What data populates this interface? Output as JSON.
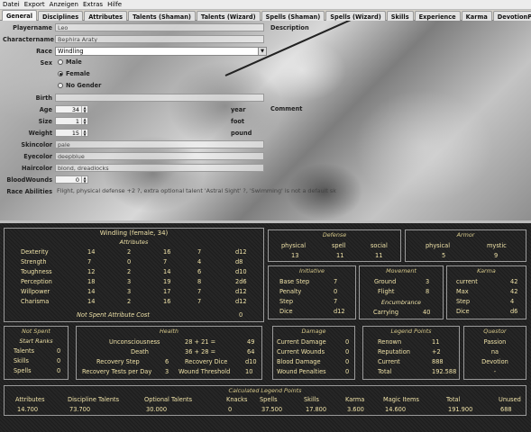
{
  "menu": [
    "Datei",
    "Export",
    "Anzeigen",
    "Extras",
    "Hilfe"
  ],
  "tabs": [
    "General",
    "Disciplines",
    "Attributes",
    "Talents (Shaman)",
    "Talents (Wizard)",
    "Spells (Shaman)",
    "Spells (Wizard)",
    "Skills",
    "Experience",
    "Karma",
    "DevotionPoints"
  ],
  "general": {
    "playername_label": "Playername",
    "playername": "Leo",
    "charactername_label": "Charactername",
    "charactername": "Bephira Araty",
    "race_label": "Race",
    "race": "Windling",
    "sex_label": "Sex",
    "sex_options": [
      "Male",
      "Female",
      "No Gender"
    ],
    "birth_label": "Birth",
    "birth": "",
    "age_label": "Age",
    "age": "34",
    "age_unit": "year",
    "size_label": "Size",
    "size": "1",
    "size_unit": "foot",
    "weight_label": "Weight",
    "weight": "15",
    "weight_unit": "pound",
    "skincolor_label": "Skincolor",
    "skincolor": "pale",
    "eyecolor_label": "Eyecolor",
    "eyecolor": "deepblue",
    "haircolor_label": "Haircolor",
    "haircolor": "blond, dreadlocks",
    "bloodwounds_label": "BloodWounds",
    "bloodwounds": "0",
    "raceabilities_label": "Race Abilities",
    "raceabilities": "Flight, physical defense +2 ?, extra optional talent 'Astral Sight' ?, 'Swimming' is not a default skill",
    "description_label": "Description",
    "comment_label": "Comment"
  },
  "sheet": {
    "title": "Windling (female, 34)",
    "attributes": {
      "header": "Attributes",
      "rows": [
        [
          "Dexterity",
          "14",
          "2",
          "16",
          "7",
          "d12"
        ],
        [
          "Strength",
          "7",
          "0",
          "7",
          "4",
          "d8"
        ],
        [
          "Toughness",
          "12",
          "2",
          "14",
          "6",
          "d10"
        ],
        [
          "Perception",
          "18",
          "3",
          "19",
          "8",
          "2d6"
        ],
        [
          "Willpower",
          "14",
          "3",
          "17",
          "7",
          "d12"
        ],
        [
          "Charisma",
          "14",
          "2",
          "16",
          "7",
          "d12"
        ]
      ],
      "not_spent_label": "Not Spent Attribute Cost",
      "not_spent": "0"
    },
    "defense": {
      "header": "Defense",
      "labels": [
        "physical",
        "spell",
        "social"
      ],
      "values": [
        "13",
        "11",
        "11"
      ]
    },
    "armor": {
      "header": "Armor",
      "labels": [
        "physical",
        "mystic"
      ],
      "values": [
        "5",
        "9"
      ]
    },
    "initiative": {
      "header": "Initiative",
      "rows": [
        [
          "Base Step",
          "7"
        ],
        [
          "Penalty",
          "0"
        ],
        [
          "Step",
          "7"
        ],
        [
          "Dice",
          "d12"
        ]
      ]
    },
    "movement": {
      "header": "Movement",
      "rows": [
        [
          "Ground",
          "3"
        ],
        [
          "Flight",
          "8"
        ]
      ],
      "encumbrance_header": "Encumbrance",
      "carrying_label": "Carrying",
      "carrying": "40"
    },
    "karma": {
      "header": "Karma",
      "rows": [
        [
          "current",
          "42"
        ],
        [
          "Max",
          "42"
        ],
        [
          "Step",
          "4"
        ],
        [
          "Dice",
          "d6"
        ]
      ]
    },
    "notspent": {
      "header": "Not Spent",
      "sub": "Start Ranks",
      "rows": [
        [
          "Talents",
          "0"
        ],
        [
          "Skills",
          "0"
        ],
        [
          "Spells",
          "0"
        ]
      ]
    },
    "health": {
      "header": "Health",
      "rows": [
        [
          "Unconsciousness",
          "28 + 21 =",
          "49"
        ],
        [
          "Death",
          "36 + 28 =",
          "64"
        ]
      ],
      "rows2": [
        [
          "Recovery Step",
          "6",
          "Recovery Dice",
          "d10"
        ],
        [
          "Recovery Tests per Day",
          "3",
          "Wound Threshold",
          "10"
        ]
      ]
    },
    "damage": {
      "header": "Damage",
      "rows": [
        [
          "Current Damage",
          "0"
        ],
        [
          "Current Wounds",
          "0"
        ],
        [
          "Blood Damage",
          "0"
        ],
        [
          "Wound Penalties",
          "0"
        ]
      ]
    },
    "legend": {
      "header": "Legend Points",
      "rows": [
        [
          "Renown",
          "11"
        ],
        [
          "Reputation",
          "+2"
        ],
        [
          "Current",
          "888"
        ],
        [
          "Total",
          "192.588"
        ]
      ]
    },
    "questor": {
      "header": "Questor",
      "passion": "Passion",
      "passion_value": "na",
      "devotion": "Devotion",
      "devotion_value": "-"
    },
    "calc": {
      "header": "Calculated Legend Points",
      "labels": [
        "Attributes",
        "Discipline Talents",
        "Optional Talents",
        "Knacks",
        "Spells",
        "Skills",
        "Karma",
        "Magic Items",
        "Total",
        "Unused"
      ],
      "values": [
        "14.700",
        "73.700",
        "30.000",
        "0",
        "37.500",
        "17.800",
        "3.600",
        "14.600",
        "191.900",
        "688"
      ]
    }
  }
}
